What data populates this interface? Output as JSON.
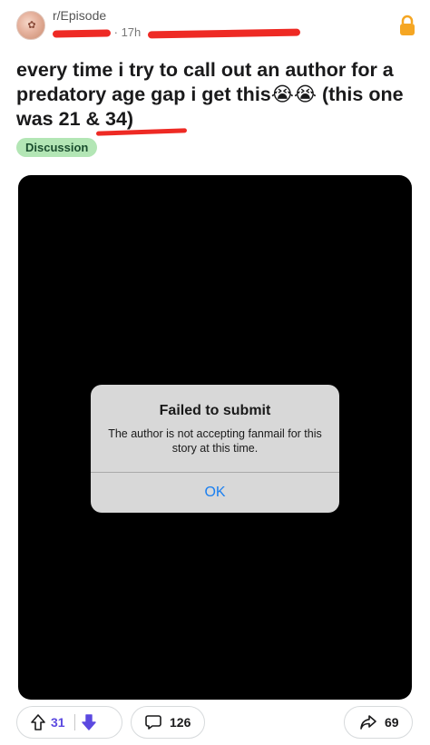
{
  "post": {
    "subreddit": "r/Episode",
    "time_ago": "· 17h",
    "title": "every time i try to call out an author for a predatory age gap i get this😭😭 (this one was 21 & 34)",
    "flair": "Discussion"
  },
  "dialog": {
    "title": "Failed to submit",
    "message": "The author is not accepting fanmail for this story at this time.",
    "ok_label": "OK"
  },
  "actions": {
    "upvotes": "31",
    "comments": "126",
    "shares": "69"
  },
  "colors": {
    "flair_bg": "#b3e6b5",
    "lock": "#f5a623",
    "ok_button": "#1a7ff0",
    "downvote": "#5b49e0",
    "redaction": "#ee2a24"
  },
  "icons": [
    "avatar",
    "lock-icon",
    "upvote-icon",
    "downvote-icon",
    "comment-icon",
    "share-icon"
  ]
}
